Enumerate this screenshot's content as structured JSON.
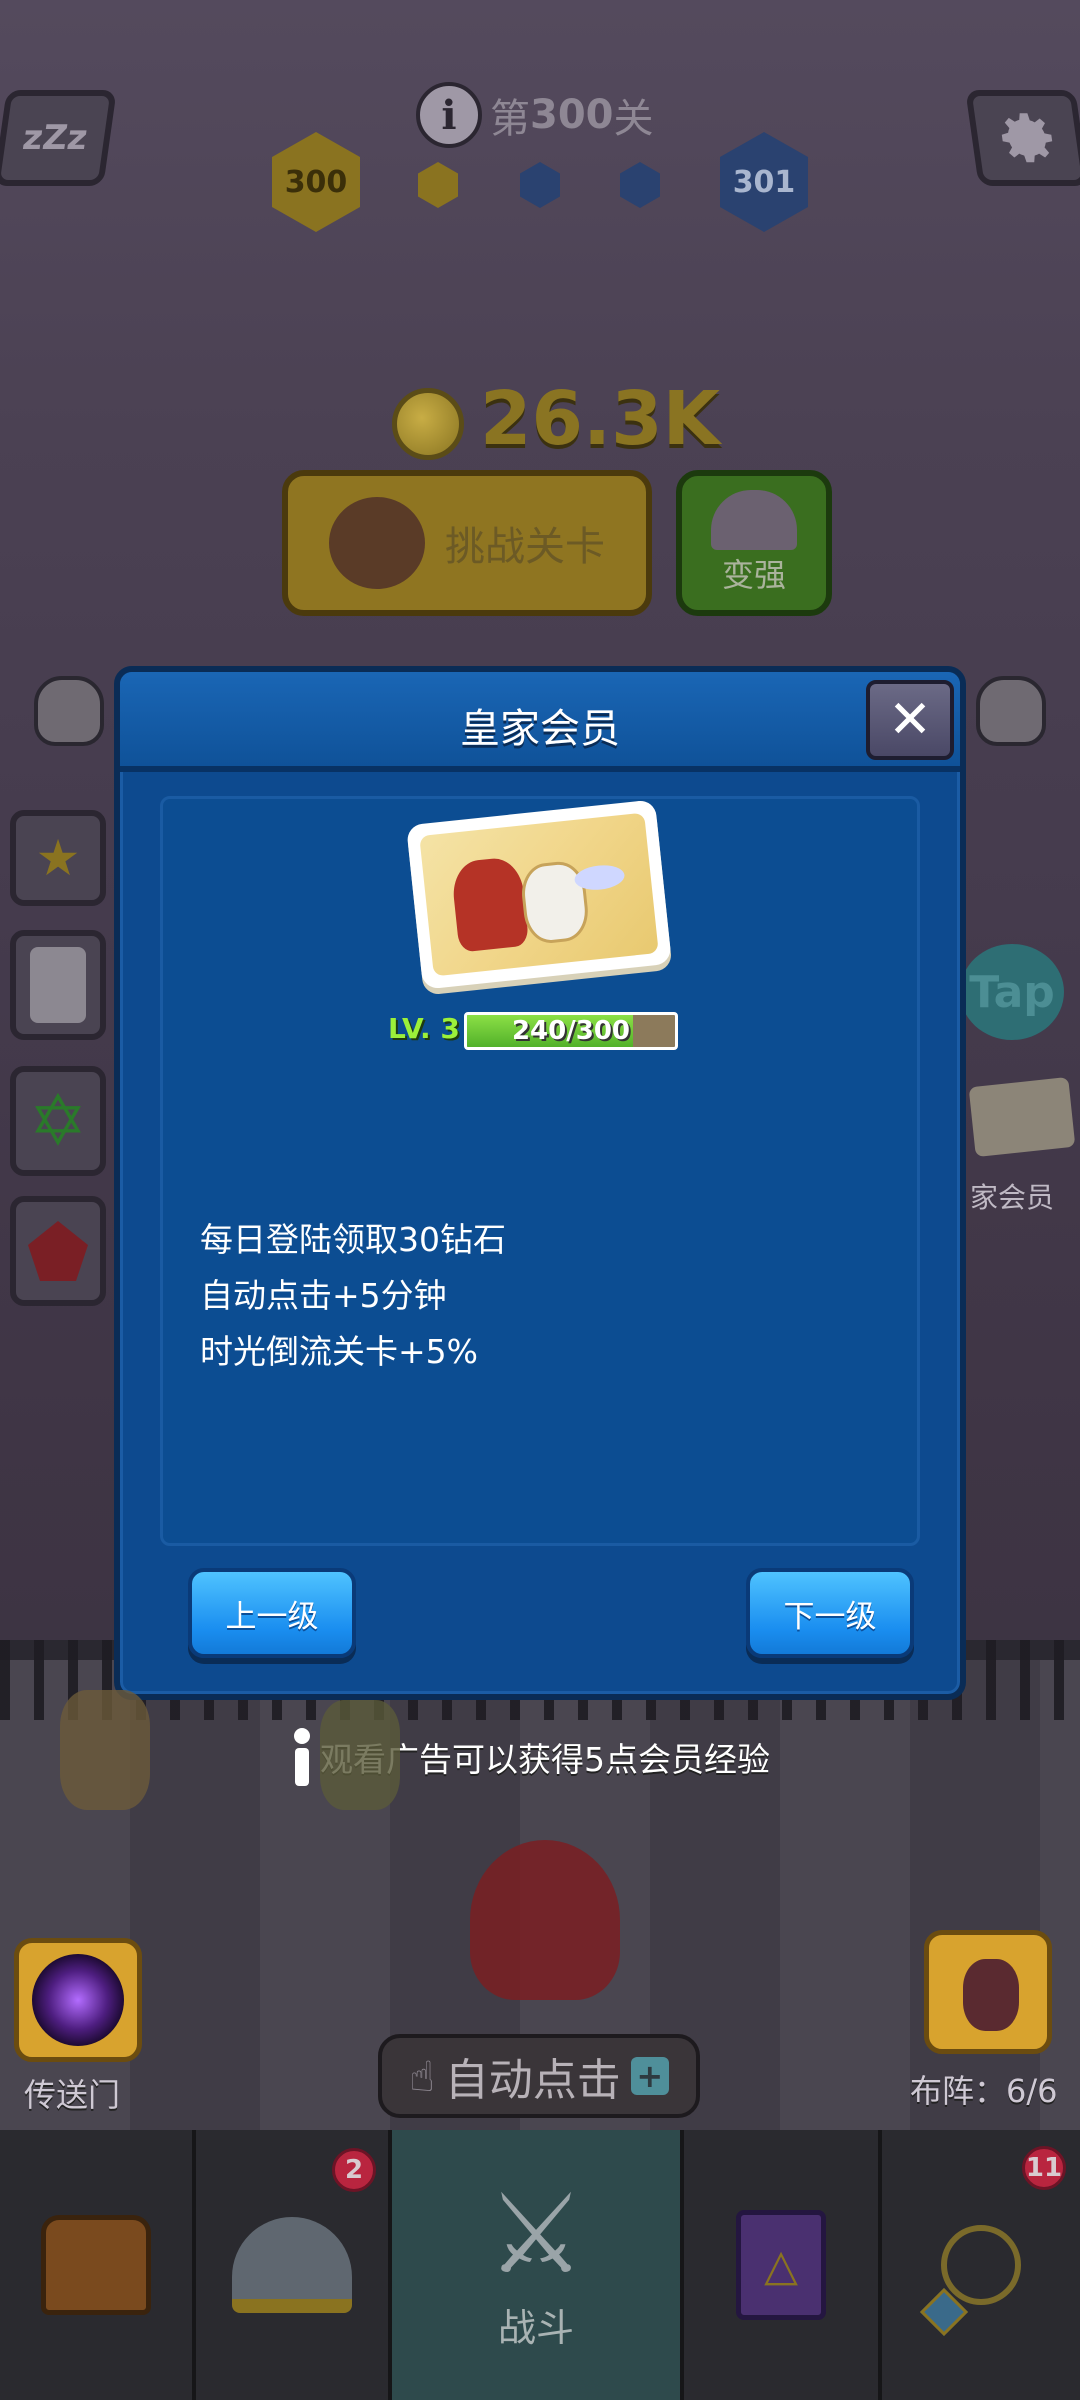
{
  "hud": {
    "level_prefix": "第",
    "level_number": "300",
    "level_suffix": "关",
    "current_level": "300",
    "next_level": "301",
    "coins": "26.3K",
    "challenge_label": "挑战关卡",
    "upgrade_label": "变强",
    "tap_label": "Tap",
    "membership_side_label": "家会员"
  },
  "modal": {
    "title": "皇家会员",
    "close_glyph": "✕",
    "level_label": "LV. 3",
    "xp_text": "240/300",
    "xp_current": 240,
    "xp_max": 300,
    "benefits": [
      "每日登陆领取30钻石",
      "自动点击+5分钟",
      "时光倒流关卡+5%"
    ],
    "prev_button": "上一级",
    "next_button": "下一级"
  },
  "hint": "观看广告可以获得5点会员经验",
  "bottom": {
    "portal_label": "传送门",
    "formation_label": "布阵：6/6",
    "auto_click_label": "自动点击",
    "auto_click_plus": "+"
  },
  "tabs": [
    {
      "name": "chest",
      "label": "",
      "badge": ""
    },
    {
      "name": "heroes",
      "label": "",
      "badge": "2"
    },
    {
      "name": "battle",
      "label": "战斗",
      "badge": ""
    },
    {
      "name": "spellbook",
      "label": "",
      "badge": ""
    },
    {
      "name": "artifacts",
      "label": "",
      "badge": "11"
    }
  ],
  "colors": {
    "modal_bg": "#0d4a8f",
    "button_blue": "#1a8ef0",
    "xp_green": "#52b12a",
    "level_green": "#9cf03a",
    "badge_red": "#b9253f"
  }
}
